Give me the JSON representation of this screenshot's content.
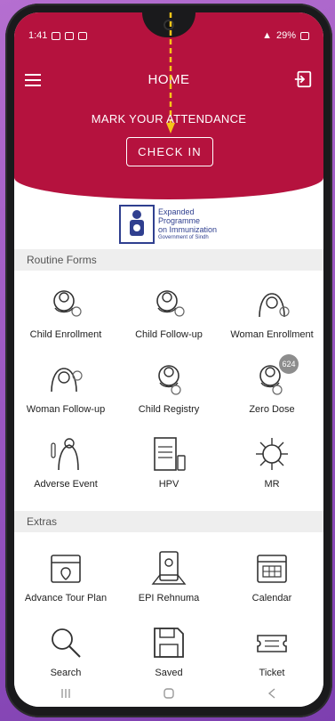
{
  "status_bar": {
    "time": "1:41",
    "battery": "29%"
  },
  "header": {
    "title": "HOME",
    "attendance_label": "MARK YOUR ATTENDANCE",
    "checkin_label": "CHECK IN",
    "color": "#b5123e"
  },
  "logo": {
    "line1": "Expanded",
    "line2": "Programme",
    "line3": "on Immunization",
    "line4": "Government of Sindh"
  },
  "routine_forms": {
    "title": "Routine Forms",
    "items": [
      {
        "label": "Child Enrollment",
        "icon": "child-enrollment-icon"
      },
      {
        "label": "Child Follow-up",
        "icon": "child-followup-icon"
      },
      {
        "label": "Woman Enrollment",
        "icon": "woman-enrollment-icon"
      },
      {
        "label": "Woman Follow-up",
        "icon": "woman-followup-icon"
      },
      {
        "label": "Child Registry",
        "icon": "child-registry-icon"
      },
      {
        "label": "Zero Dose",
        "icon": "zero-dose-icon",
        "badge": "624"
      },
      {
        "label": "Adverse Event",
        "icon": "adverse-event-icon"
      },
      {
        "label": "HPV",
        "icon": "hpv-icon"
      },
      {
        "label": "MR",
        "icon": "mr-virus-icon"
      }
    ]
  },
  "extras": {
    "title": "Extras",
    "items": [
      {
        "label": "Advance Tour Plan",
        "icon": "tour-plan-icon"
      },
      {
        "label": "EPI Rehnuma",
        "icon": "epi-rehnuma-icon"
      },
      {
        "label": "Calendar",
        "icon": "calendar-icon"
      },
      {
        "label": "Search",
        "icon": "search-icon"
      },
      {
        "label": "Saved",
        "icon": "save-icon"
      },
      {
        "label": "Ticket",
        "icon": "ticket-icon"
      }
    ]
  }
}
